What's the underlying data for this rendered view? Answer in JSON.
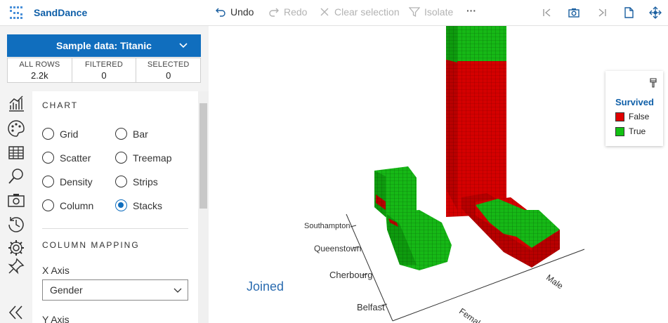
{
  "app": {
    "title": "SandDance",
    "logo_icon": "sanddance-logo-icon"
  },
  "toolbar": {
    "undo": "Undo",
    "redo": "Redo",
    "clear_selection": "Clear selection",
    "isolate": "Isolate",
    "more": "···"
  },
  "sidebar": {
    "sample_button": "Sample data: Titanic",
    "counts": [
      {
        "label": "ALL ROWS",
        "value": "2.2k"
      },
      {
        "label": "FILTERED",
        "value": "0"
      },
      {
        "label": "SELECTED",
        "value": "0"
      }
    ],
    "chart_section": "CHART",
    "chart_types": [
      {
        "label": "Grid",
        "checked": false
      },
      {
        "label": "Bar",
        "checked": false
      },
      {
        "label": "Scatter",
        "checked": false
      },
      {
        "label": "Treemap",
        "checked": false
      },
      {
        "label": "Density",
        "checked": false
      },
      {
        "label": "Strips",
        "checked": false
      },
      {
        "label": "Column",
        "checked": false
      },
      {
        "label": "Stacks",
        "checked": true
      }
    ],
    "mapping_section": "COLUMN MAPPING",
    "x_axis_label": "X Axis",
    "x_axis_value": "Gender",
    "y_axis_label": "Y Axis"
  },
  "chart": {
    "legend_title": "Survived",
    "legend_items": [
      {
        "label": "False",
        "color": "#e00000"
      },
      {
        "label": "True",
        "color": "#13c113"
      }
    ],
    "axis_title": "Joined",
    "y_ticks": [
      "Southampton",
      "Queenstown",
      "Cherbourg",
      "Belfast"
    ],
    "x_ticks": [
      "Male",
      "Femal"
    ],
    "colors": {
      "false": "#d90000",
      "true": "#12b512"
    }
  }
}
